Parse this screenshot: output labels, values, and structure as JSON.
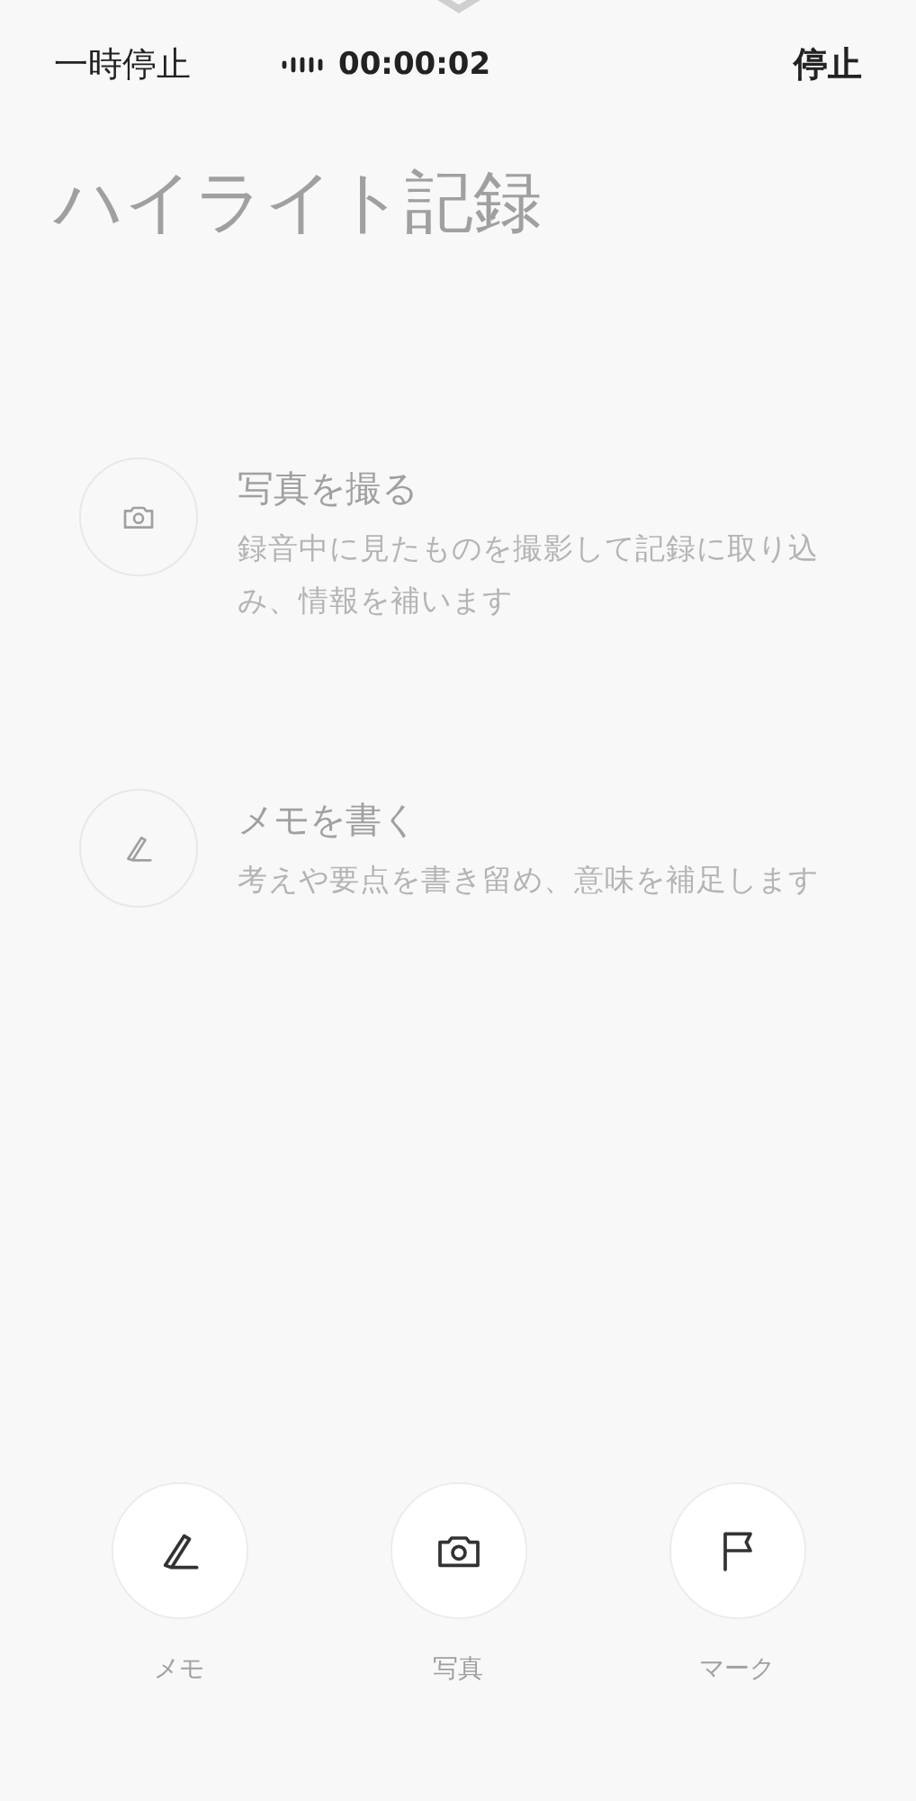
{
  "top_bar": {
    "pause": "一時停止",
    "timer": "00:00:02",
    "stop": "停止"
  },
  "title": "ハイライト記録",
  "hints": [
    {
      "kind": "camera",
      "title": "写真を撮る",
      "description": "録音中に見たものを撮影して記録に取り込み、情報を補います"
    },
    {
      "kind": "pen",
      "title": "メモを書く",
      "description": "考えや要点を書き留め、意味を補足します"
    }
  ],
  "actions": [
    {
      "kind": "pen",
      "label": "メモ"
    },
    {
      "kind": "camera",
      "label": "写真"
    },
    {
      "kind": "flag",
      "label": "マーク"
    }
  ]
}
